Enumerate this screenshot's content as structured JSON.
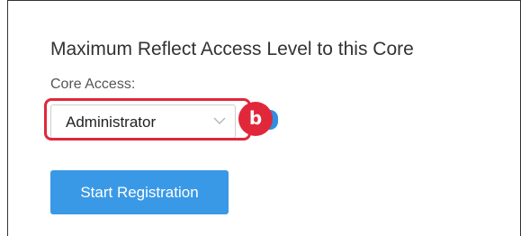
{
  "section": {
    "title": "Maximum Reflect Access Level to this Core"
  },
  "core_access": {
    "label": "Core Access:",
    "selected": "Administrator",
    "arrow_icon": "chevron-down-icon"
  },
  "annotation": {
    "badge_text": "b",
    "color": "#e0283a"
  },
  "actions": {
    "start_registration": "Start Registration"
  },
  "colors": {
    "primary": "#3a99e6",
    "text": "#333333"
  }
}
